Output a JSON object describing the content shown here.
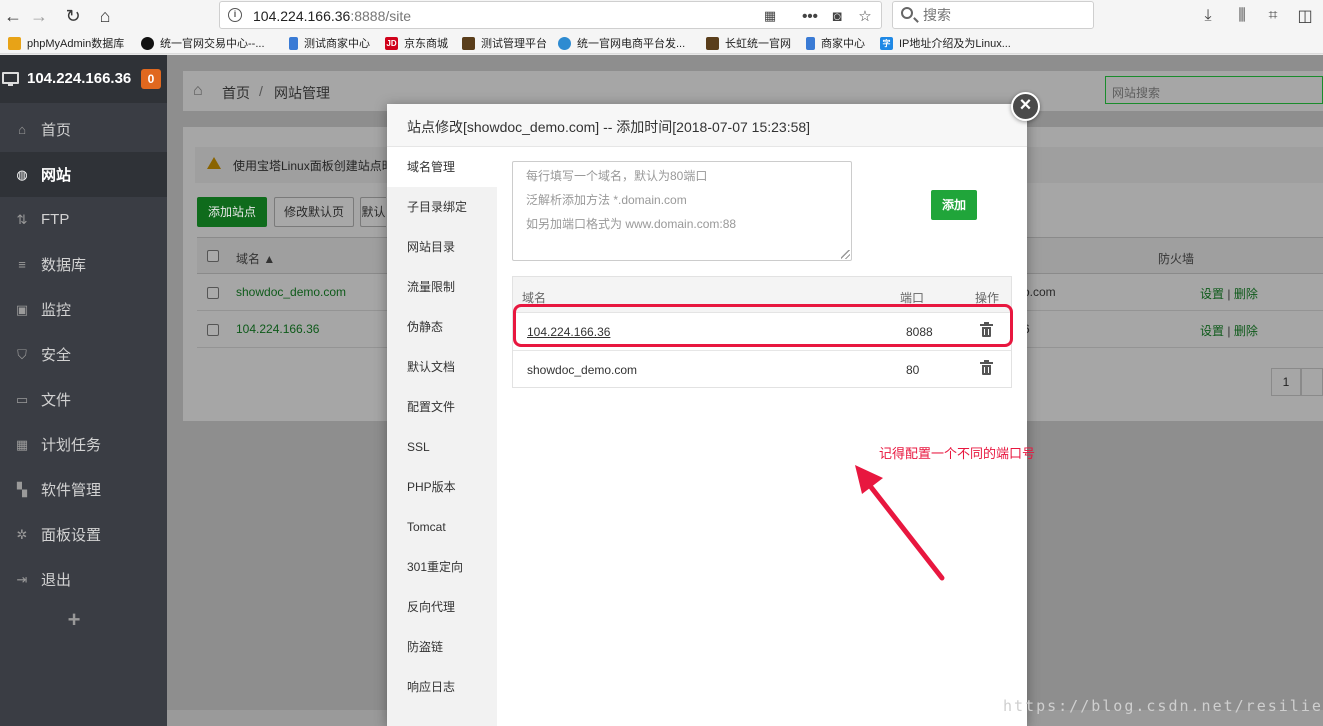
{
  "browser": {
    "url_host": "104.224.166.36",
    "url_rest": ":8888/site",
    "search_placeholder": "搜索"
  },
  "bookmarks": [
    {
      "label": "phpMyAdmin数据库",
      "color": "#e8a317"
    },
    {
      "label": "统一官网交易中心--...",
      "color": "#111111"
    },
    {
      "label": "测试商家中心",
      "color": "#3a7bd5"
    },
    {
      "label": "京东商城",
      "color": "#d0021b"
    },
    {
      "label": "测试管理平台",
      "color": "#5a3e1b"
    },
    {
      "label": "统一官网电商平台发...",
      "color": "#2e8bd1"
    },
    {
      "label": "长虹统一官网",
      "color": "#5a3e1b"
    },
    {
      "label": "商家中心",
      "color": "#3a7bd5"
    },
    {
      "label": "IP地址介绍及为Linux...",
      "color": "#1e88e5"
    }
  ],
  "sidebar": {
    "ip": "104.224.166.36",
    "badge": "0",
    "items": [
      {
        "label": "首页",
        "icon": "home-icon",
        "glyph": "⌂"
      },
      {
        "label": "网站",
        "icon": "globe-icon",
        "glyph": "◍"
      },
      {
        "label": "FTP",
        "icon": "ftp-icon",
        "glyph": "⇅"
      },
      {
        "label": "数据库",
        "icon": "database-icon",
        "glyph": "≡"
      },
      {
        "label": "监控",
        "icon": "monitor-icon",
        "glyph": "▣"
      },
      {
        "label": "安全",
        "icon": "shield-icon",
        "glyph": "⛉"
      },
      {
        "label": "文件",
        "icon": "folder-icon",
        "glyph": "▭"
      },
      {
        "label": "计划任务",
        "icon": "calendar-icon",
        "glyph": "▦"
      },
      {
        "label": "软件管理",
        "icon": "apps-icon",
        "glyph": "▚"
      },
      {
        "label": "面板设置",
        "icon": "gear-icon",
        "glyph": "✲"
      },
      {
        "label": "退出",
        "icon": "logout-icon",
        "glyph": "⇥"
      }
    ],
    "plus": "+"
  },
  "page": {
    "crumb_home": "首页",
    "crumb_sep": "/",
    "crumb_current": "网站管理",
    "site_search_placeholder": "网站搜索",
    "warning_text": "使用宝塔Linux面板创建站点时",
    "btn_add_site": "添加站点",
    "btn_modify_default": "修改默认页",
    "btn_default_partial": "默认",
    "col_domain": "域名 ▲",
    "col_firewall": "防火墙",
    "rows": [
      {
        "domain": "showdoc_demo.com",
        "right": "o.com",
        "set": "设置",
        "sep": "|",
        "del": "删除"
      },
      {
        "domain": "104.224.166.36",
        "right": "6",
        "set": "设置",
        "sep": "|",
        "del": "删除"
      }
    ],
    "pager": "1"
  },
  "modal": {
    "title": "站点修改[showdoc_demo.com] -- 添加时间[2018-07-07 15:23:58]",
    "close": "×",
    "tabs": [
      "域名管理",
      "子目录绑定",
      "网站目录",
      "流量限制",
      "伪静态",
      "默认文档",
      "配置文件",
      "SSL",
      "PHP版本",
      "Tomcat",
      "301重定向",
      "反向代理",
      "防盗链",
      "响应日志"
    ],
    "textarea_hints": [
      "每行填写一个域名，默认为80端口",
      "泛解析添加方法 *.domain.com",
      "如另加端口格式为 www.domain.com:88"
    ],
    "add_button": "添加",
    "table_headers": {
      "domain": "域名",
      "port": "端口",
      "op": "操作"
    },
    "domains": [
      {
        "domain": "104.224.166.36",
        "port": "8088"
      },
      {
        "domain": "showdoc_demo.com",
        "port": "80"
      }
    ]
  },
  "annotation": {
    "note": "记得配置一个不同的端口号",
    "color": "#e8173f"
  },
  "watermark": "https://blog.csdn.net/resilient"
}
